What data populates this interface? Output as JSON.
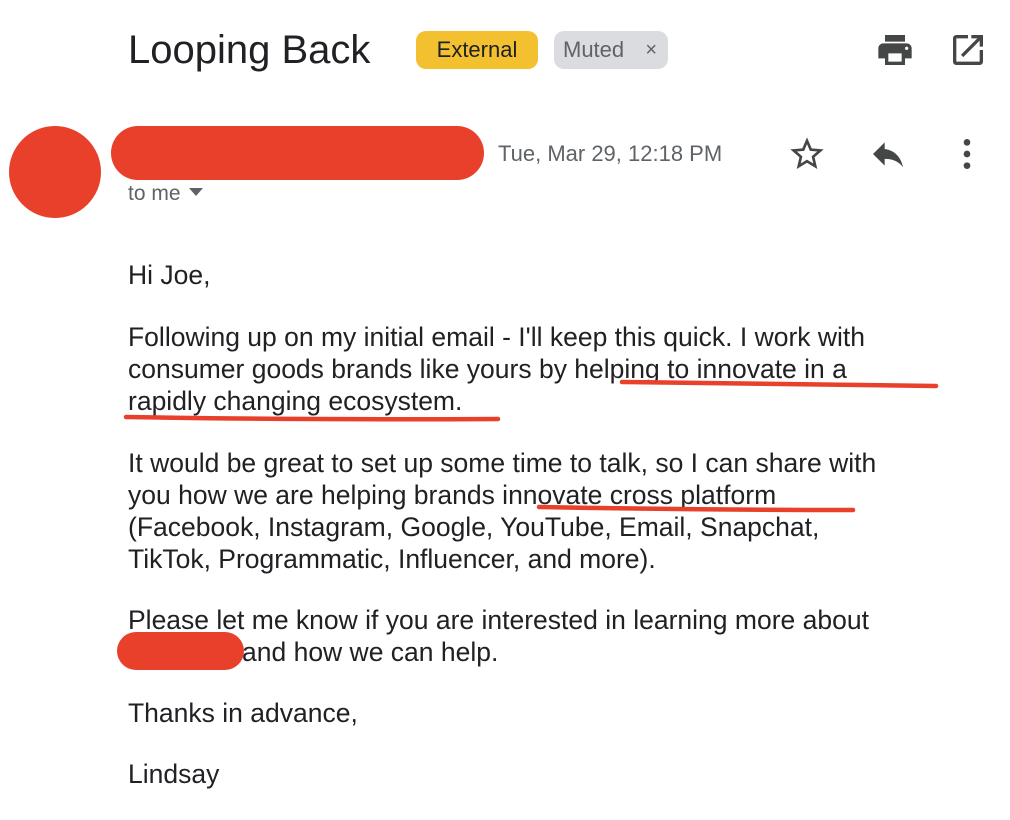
{
  "header": {
    "subject": "Looping Back",
    "labels": [
      {
        "text": "External",
        "color": "#f3c12f"
      },
      {
        "text": "Muted",
        "remove_glyph": "×",
        "color": "#dadce0"
      }
    ],
    "icons": [
      "print-icon",
      "open-in-new-window-icon"
    ]
  },
  "message": {
    "sender_name_redacted": true,
    "date": "Tue, Mar 29, 12:18 PM",
    "recipient_label": "to me",
    "actions": [
      "star-icon",
      "reply-icon",
      "more-vert-icon"
    ],
    "greeting": "Hi Joe,",
    "paragraph1": {
      "lines": [
        "Following up on my initial email - I'll keep this quick. I work with",
        "consumer goods brands like yours by helping to innovate in a",
        "rapidly changing ecosystem."
      ]
    },
    "paragraph2": {
      "lines": [
        "It would be great to set up some time to talk, so I can share with",
        "you how we are helping brands innovate cross platform",
        "(Facebook, Instagram, Google, YouTube, Email, Snapchat,",
        "TikTok, Programmatic, Influencer, and more)."
      ]
    },
    "paragraph3": {
      "lines": [
        "Please let me know if you are interested in learning more about",
        "and how we can help."
      ]
    },
    "closing": "Thanks in advance,",
    "signature": "Lindsay"
  },
  "annotations": {
    "redaction_color": "#e8402a",
    "underline_color": "#e8402a",
    "underlined_phrases": [
      "helping to innovate in a",
      "rapidly changing ecosystem.",
      "innovate cross platform"
    ]
  }
}
